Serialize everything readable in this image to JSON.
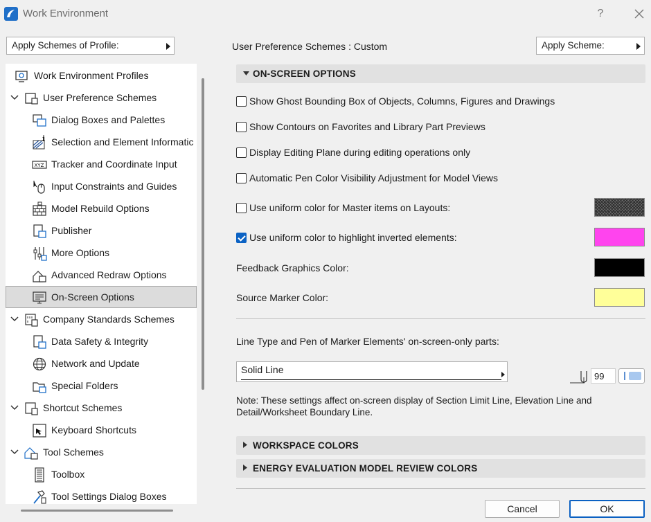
{
  "window": {
    "title": "Work Environment",
    "help_label": "?"
  },
  "profile": {
    "label": "Apply Schemes of Profile:"
  },
  "tree": {
    "items": [
      {
        "label": "Work Environment Profiles"
      },
      {
        "label": "User Preference Schemes"
      },
      {
        "label": "Dialog Boxes and Palettes"
      },
      {
        "label": "Selection and Element Informatic"
      },
      {
        "label": "Tracker and Coordinate Input"
      },
      {
        "label": "Input Constraints and Guides"
      },
      {
        "label": "Model Rebuild Options"
      },
      {
        "label": "Publisher"
      },
      {
        "label": "More Options"
      },
      {
        "label": "Advanced Redraw Options"
      },
      {
        "label": "On-Screen Options"
      },
      {
        "label": "Company Standards Schemes"
      },
      {
        "label": "Data Safety & Integrity"
      },
      {
        "label": "Network and Update"
      },
      {
        "label": "Special Folders"
      },
      {
        "label": "Shortcut Schemes"
      },
      {
        "label": "Keyboard Shortcuts"
      },
      {
        "label": "Tool Schemes"
      },
      {
        "label": "Toolbox"
      },
      {
        "label": "Tool Settings Dialog Boxes"
      }
    ]
  },
  "scheme": {
    "label": "User Preference Schemes :  Custom",
    "apply_label": "Apply Scheme:"
  },
  "sections": {
    "onscreen": "ON-SCREEN OPTIONS",
    "workspace": "WORKSPACE COLORS",
    "energy": "ENERGY EVALUATION MODEL REVIEW COLORS"
  },
  "options": [
    {
      "label": "Show Ghost Bounding Box of Objects, Columns, Figures and Drawings",
      "checked": false
    },
    {
      "label": "Show Contours on Favorites and Library Part Previews",
      "checked": false
    },
    {
      "label": "Display Editing Plane during editing operations only",
      "checked": false
    },
    {
      "label": "Automatic Pen Color Visibility Adjustment for Model Views",
      "checked": false
    },
    {
      "label": "Use uniform color for Master items on Layouts:",
      "checked": false
    },
    {
      "label": "Use uniform color to highlight inverted elements:",
      "checked": true
    }
  ],
  "colors": {
    "master": "#6a6a6a",
    "inverted": "#ff44ee",
    "feedback": "#000000",
    "source_marker": "#ffff99"
  },
  "feedback_label": "Feedback Graphics Color:",
  "source_marker_label": "Source Marker Color:",
  "marker": {
    "label": "Line Type and Pen of Marker Elements' on-screen-only parts:",
    "line_type": "Solid Line",
    "pen_number": "99"
  },
  "note": "Note: These settings affect on-screen display of Section Limit Line, Elevation Line and Detail/Worksheet Boundary Line.",
  "buttons": {
    "cancel": "Cancel",
    "ok": "OK"
  }
}
